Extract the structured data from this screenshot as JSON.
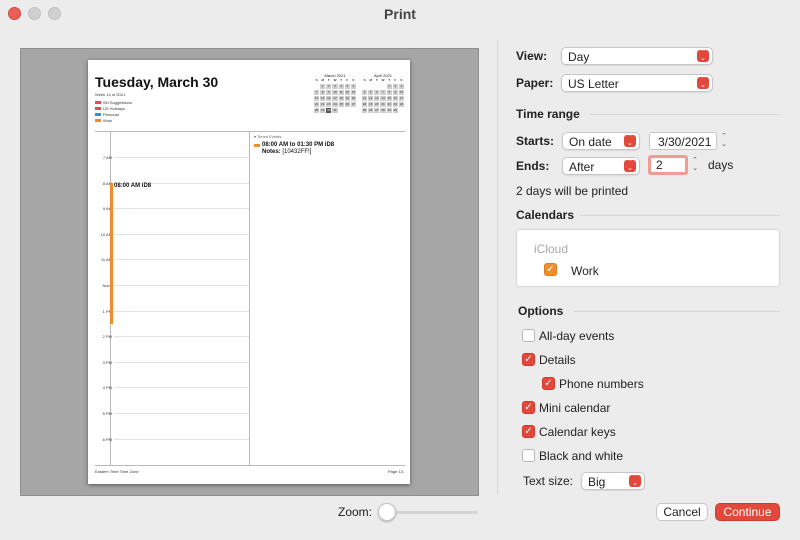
{
  "window": {
    "title": "Print"
  },
  "preview": {
    "title": "Tuesday, March 30",
    "week": "Week 14 of 2021",
    "keys": [
      {
        "label": "Siri Suggestions",
        "color": "#e24a5a"
      },
      {
        "label": "US Holidays",
        "color": "#e24a5a"
      },
      {
        "label": "Personal",
        "color": "#3b8de8"
      },
      {
        "label": "Work",
        "color": "#f08d2b"
      }
    ],
    "mini_calendars": [
      {
        "title": "March 2021",
        "cells": [
          "S",
          "M",
          "T",
          "W",
          "T",
          "F",
          "S",
          "",
          "1",
          "2",
          "3",
          "4",
          "5",
          "6",
          "7",
          "8",
          "9",
          "10",
          "11",
          "12",
          "13",
          "14",
          "15",
          "16",
          "17",
          "18",
          "19",
          "20",
          "21",
          "22",
          "23",
          "24",
          "25",
          "26",
          "27",
          "28",
          "29",
          "30",
          "31",
          "",
          "",
          ""
        ]
      },
      {
        "title": "April 2021",
        "cells": [
          "S",
          "M",
          "T",
          "W",
          "T",
          "F",
          "S",
          "",
          "",
          "",
          "",
          "1",
          "2",
          "3",
          "4",
          "5",
          "6",
          "7",
          "8",
          "9",
          "10",
          "11",
          "12",
          "13",
          "14",
          "15",
          "16",
          "17",
          "18",
          "19",
          "20",
          "21",
          "22",
          "23",
          "24",
          "25",
          "26",
          "27",
          "28",
          "29",
          "30",
          ""
        ]
      }
    ],
    "hours": [
      "7 AM",
      "8 AM",
      "9 AM",
      "10 AM",
      "11 AM",
      "Noon",
      "1 PM",
      "2 PM",
      "3 PM",
      "4 PM",
      "5 PM",
      "6 PM"
    ],
    "event_label": "08:00 AM iD8",
    "timed_events_title": "▾ Timed Events",
    "detail_time": "08:00 AM to 01:30 PM iD8",
    "detail_notes_label": "Notes:",
    "detail_notes_value": "[10432FF!]",
    "footer_left": "Eastern Time Time Zone",
    "footer_right": "Page 1/1"
  },
  "zoom": {
    "label": "Zoom:",
    "level": 0
  },
  "settings": {
    "view_label": "View:",
    "view_value": "Day",
    "paper_label": "Paper:",
    "paper_value": "US Letter",
    "time_range_title": "Time range",
    "starts_label": "Starts:",
    "starts_mode": "On date",
    "starts_date": "3/30/2021",
    "ends_label": "Ends:",
    "ends_mode": "After",
    "ends_count": "2",
    "ends_unit": "days",
    "summary": "2 days will be printed",
    "calendars_title": "Calendars",
    "calendar_group": "iCloud",
    "calendar_item": "Work",
    "options_title": "Options",
    "options": [
      {
        "label": "All-day events",
        "checked": false
      },
      {
        "label": "Details",
        "checked": true
      },
      {
        "label": "Phone numbers",
        "checked": true
      },
      {
        "label": "Mini calendar",
        "checked": true
      },
      {
        "label": "Calendar keys",
        "checked": true
      },
      {
        "label": "Black and white",
        "checked": false
      }
    ],
    "text_size_label": "Text size:",
    "text_size_value": "Big"
  },
  "buttons": {
    "cancel": "Cancel",
    "continue": "Continue"
  },
  "colors": {
    "accent": "#e2483b",
    "work": "#f08d2b"
  }
}
